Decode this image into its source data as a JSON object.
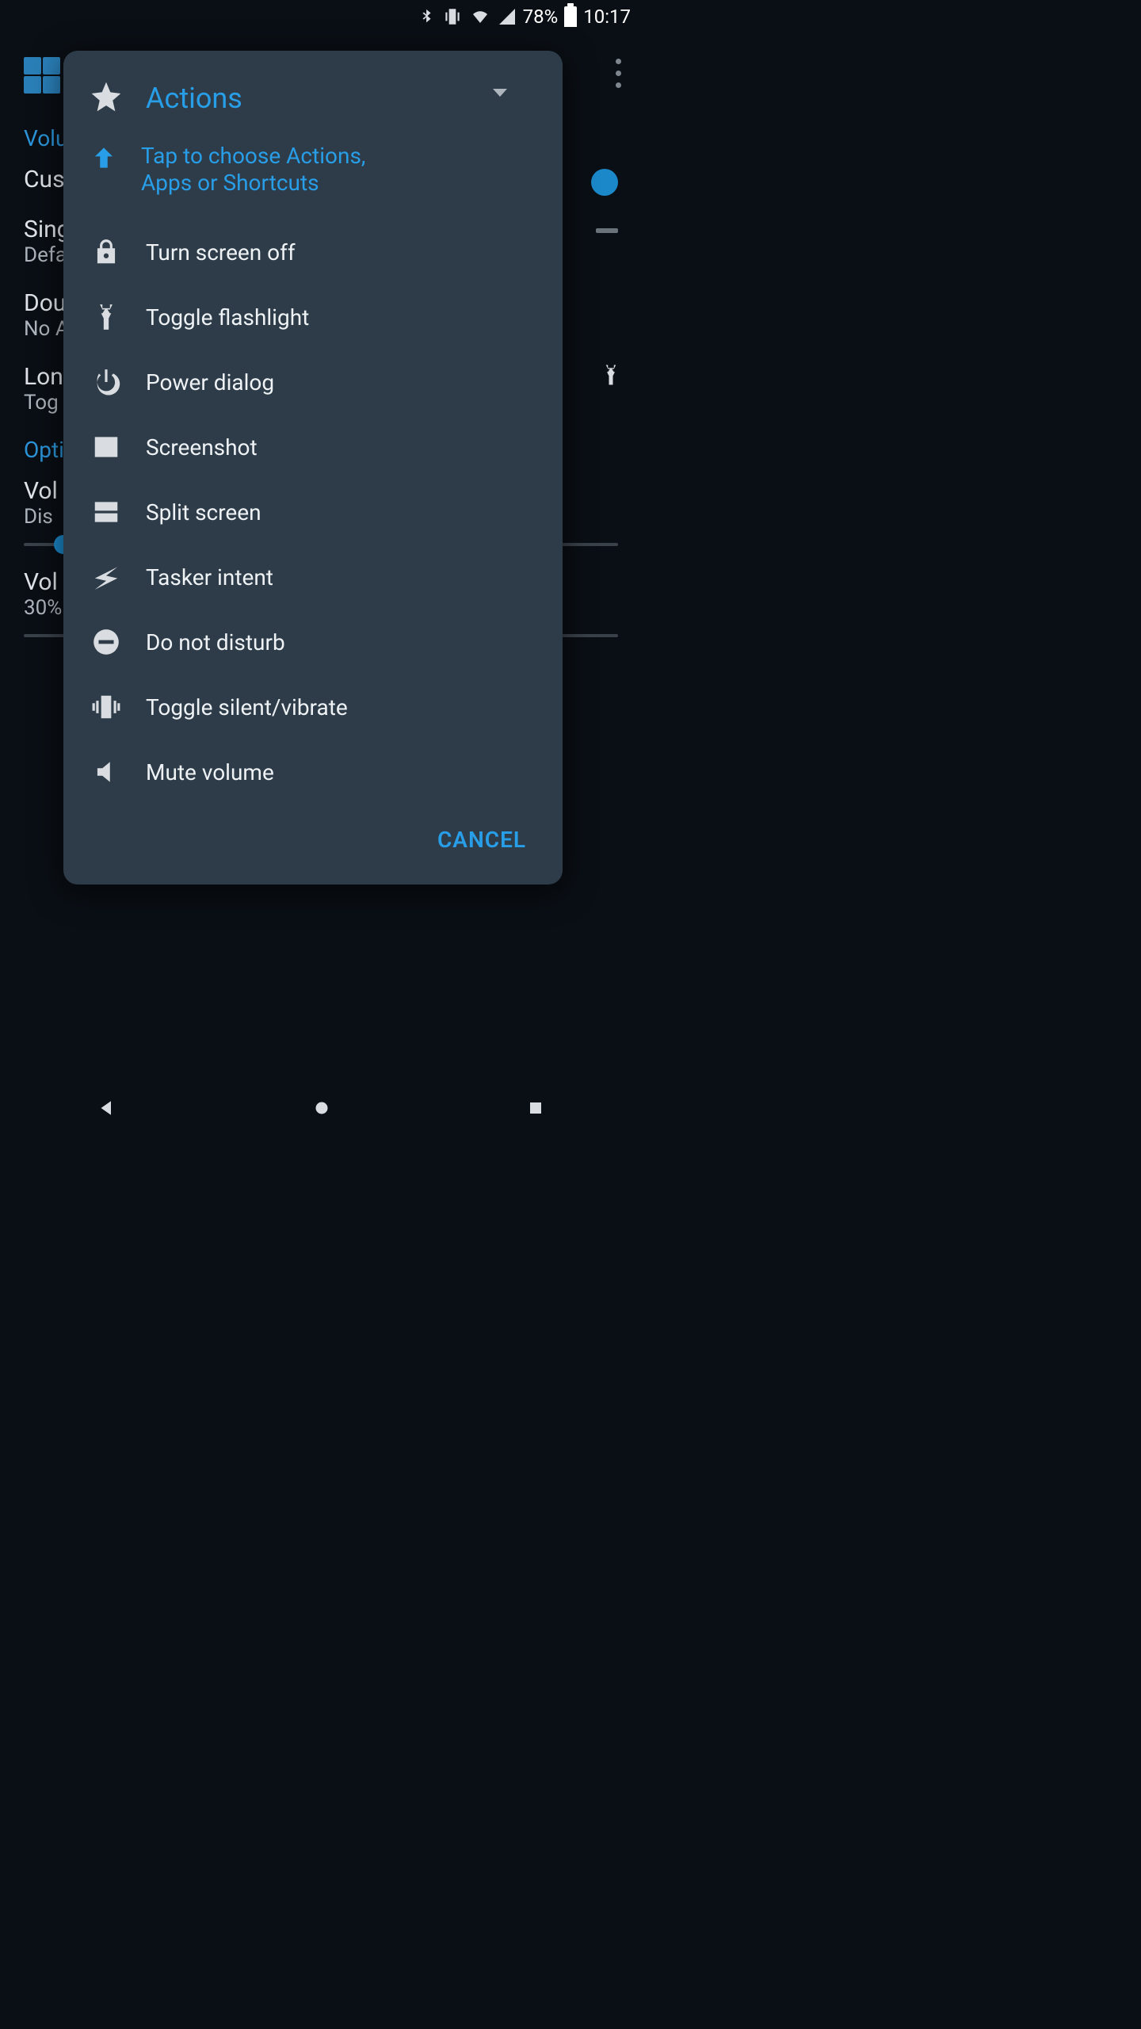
{
  "status_bar": {
    "battery_pct": "78%",
    "clock": "10:17"
  },
  "background": {
    "section1": "Volu",
    "row1_t": "Cus",
    "row2_t": "Sing",
    "row2_s": "Defa",
    "row3_t": "Dou",
    "row3_s": "No A",
    "row4_t": "Lon",
    "row4_s": "Tog",
    "section2": "Opti",
    "row5_t": "Vol",
    "row5_s": "Dis",
    "row6_t": "Vol",
    "row6_s": "30%"
  },
  "dialog": {
    "title": "Actions",
    "hint": "Tap to choose Actions, Apps or Shortcuts",
    "actions": [
      {
        "icon": "lock-icon",
        "label": "Turn screen off"
      },
      {
        "icon": "flashlight-icon",
        "label": "Toggle flashlight"
      },
      {
        "icon": "power-icon",
        "label": "Power dialog"
      },
      {
        "icon": "image-icon",
        "label": "Screenshot"
      },
      {
        "icon": "split-icon",
        "label": "Split screen"
      },
      {
        "icon": "bolt-icon",
        "label": "Tasker intent"
      },
      {
        "icon": "dnd-icon",
        "label": "Do not disturb"
      },
      {
        "icon": "vibrate-icon",
        "label": "Toggle silent/vibrate"
      },
      {
        "icon": "mute-icon",
        "label": "Mute volume"
      }
    ],
    "cancel": "CANCEL"
  }
}
